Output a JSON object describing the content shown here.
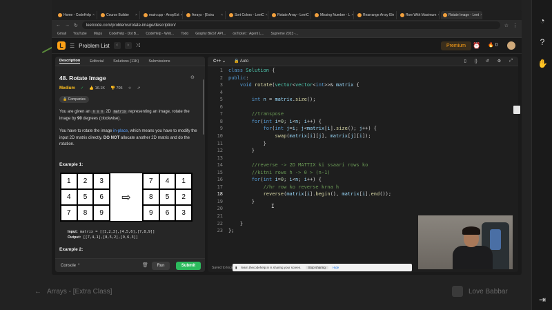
{
  "browser": {
    "tabs": [
      {
        "label": "Home - CodeHelp",
        "active": false
      },
      {
        "label": "Course Builder",
        "active": false
      },
      {
        "label": "main.cpp - ArrayExt",
        "active": false
      },
      {
        "label": "Arrays - [Extra",
        "active": false
      },
      {
        "label": "Sort Colors - LeetC",
        "active": false
      },
      {
        "label": "Rotate Array - LeetC",
        "active": false
      },
      {
        "label": "Missing Number - L",
        "active": false
      },
      {
        "label": "Rearrange Array Ele",
        "active": false
      },
      {
        "label": "Row With Maximum",
        "active": false
      },
      {
        "label": "Rotate Image - Leet",
        "active": true
      }
    ],
    "url": "leetcode.com/problems/rotate-image/description/",
    "bookmarks": [
      "Gmail",
      "YouTube",
      "Maps",
      "CodeHelp - Dot B...",
      "CodeHelp - Web...",
      "Todo",
      "Graphy BEST API...",
      "osTicket :: Agent L...",
      "Supreme 2023 -..."
    ]
  },
  "header": {
    "problem_list": "Problem List",
    "premium": "Premium",
    "fire_count": "0"
  },
  "left_panel": {
    "tabs": [
      "Description",
      "Editorial",
      "Solutions (11K)",
      "Submissions"
    ],
    "title": "48. Rotate Image",
    "difficulty": "Medium",
    "likes": "16.1K",
    "dislikes": "705",
    "companies": "Companies",
    "desc1_a": "You are given an ",
    "desc1_code1": "n x n",
    "desc1_b": " 2D ",
    "desc1_code2": "matrix",
    "desc1_c": " representing an image, rotate the image by ",
    "desc1_d": "90",
    "desc1_e": " degrees (clockwise).",
    "desc2_a": "You have to rotate the image ",
    "desc2_link": "in-place",
    "desc2_b": ", which means you have to modify the input 2D matrix directly. ",
    "desc2_bold": "DO NOT",
    "desc2_c": " allocate another 2D matrix and do the rotation.",
    "example1": "Example 1:",
    "input_label": "Input:",
    "input_value": "matrix = [[1,2,3],[4,5,6],[7,8,9]]",
    "output_label": "Output:",
    "output_value": "[[7,4,1],[8,5,2],[9,6,3]]",
    "example2": "Example 2:",
    "matrix_in": [
      "1",
      "2",
      "3",
      "4",
      "5",
      "6",
      "7",
      "8",
      "9"
    ],
    "matrix_out": [
      "7",
      "4",
      "1",
      "8",
      "5",
      "2",
      "9",
      "6",
      "3"
    ],
    "arrow": "⇨",
    "console": "Console",
    "run": "Run",
    "submit": "Submit"
  },
  "editor": {
    "language": "C++",
    "mode": "Auto",
    "saved": "Saved to local",
    "current_line": 18,
    "line_numbers": [
      "1",
      "2",
      "3",
      "4",
      "5",
      "6",
      "7",
      "8",
      "9",
      "10",
      "11",
      "12",
      "13",
      "14",
      "15",
      "16",
      "17",
      "18",
      "19",
      "20",
      "21",
      "22",
      "23"
    ]
  },
  "share_bar": {
    "text": "learn.thecodehelp.in is sharing your screen.",
    "stop": "Stop sharing",
    "hide": "Hide"
  },
  "background": {
    "left_title": "Arrays - [Extra Class]",
    "right_name": "Love Babbar"
  }
}
